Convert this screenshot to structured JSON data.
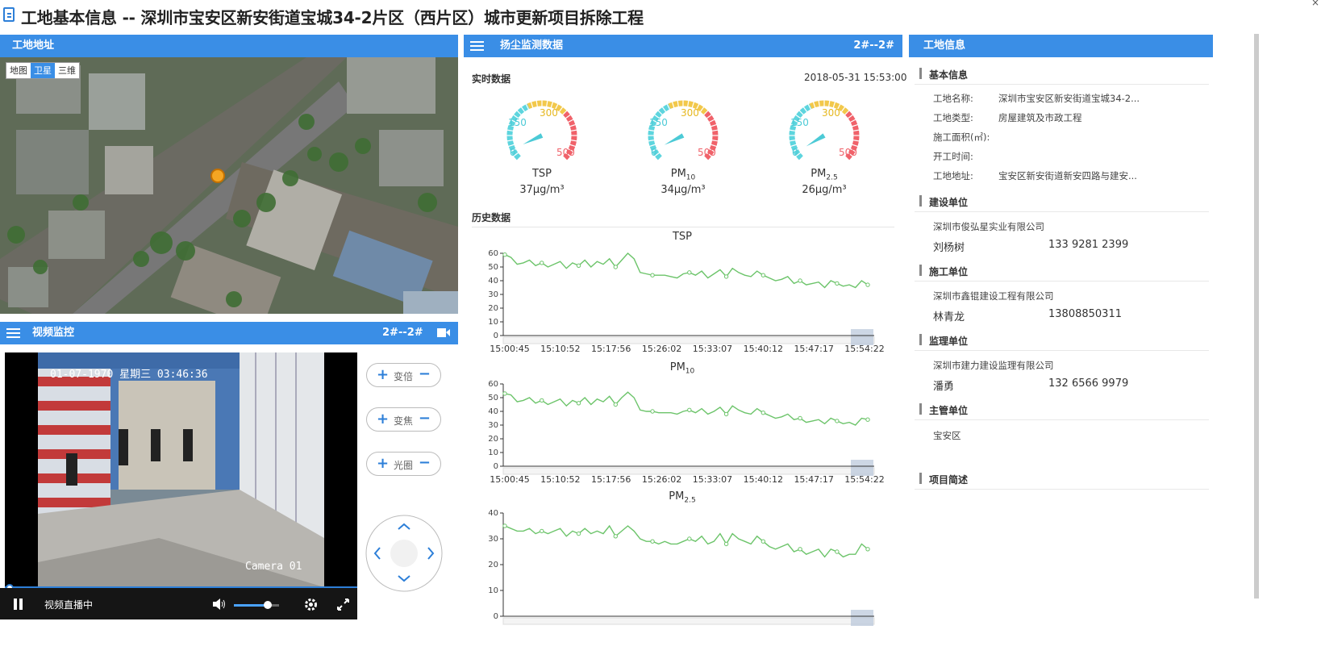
{
  "page": {
    "title": "工地基本信息 -- 深圳市宝安区新安街道宝城34-2片区（西片区）城市更新项目拆除工程",
    "close": "×"
  },
  "map_panel": {
    "title": "工地地址",
    "tabs": [
      "地图",
      "卫星",
      "三维"
    ],
    "active_tab": "卫星"
  },
  "video_panel": {
    "title": "视频监控",
    "camera_id": "2#--2#",
    "osd_datetime": "01-07-1970 星期三 03:46:36",
    "osd_camera": "Camera 01",
    "status": "视频直播中",
    "volume": 0.75,
    "controls": [
      {
        "label": "变倍",
        "plus": "+",
        "minus": "−"
      },
      {
        "label": "变焦",
        "plus": "+",
        "minus": "−"
      },
      {
        "label": "光圈",
        "plus": "+",
        "minus": "−"
      }
    ]
  },
  "dust_panel": {
    "title": "扬尘监测数据",
    "device": "2#--2#",
    "realtime_label": "实时数据",
    "timestamp": "2018-05-31 15:53:00",
    "history_label": "历史数据",
    "gauges": [
      {
        "name": "TSP",
        "sub": "",
        "value": "37μg/m³",
        "level": 37
      },
      {
        "name": "PM",
        "sub": "10",
        "value": "34μg/m³",
        "level": 34
      },
      {
        "name": "PM",
        "sub": "2.5",
        "value": "26μg/m³",
        "level": 26
      }
    ],
    "gauge_ticks": [
      "0",
      "150",
      "300",
      "500"
    ]
  },
  "chart_data": [
    {
      "type": "line",
      "title": "TSP",
      "ylim": [
        0,
        60
      ],
      "yticks": [
        0,
        10,
        20,
        30,
        40,
        50,
        60
      ],
      "xticks": [
        "15:00:45",
        "15:10:52",
        "15:17:56",
        "15:26:02",
        "15:33:07",
        "15:40:12",
        "15:47:17",
        "15:54:22"
      ],
      "values": [
        59,
        57,
        52,
        53,
        55,
        51,
        53,
        50,
        52,
        54,
        49,
        53,
        51,
        55,
        50,
        54,
        52,
        56,
        50,
        55,
        60,
        56,
        46,
        45,
        44,
        44,
        44,
        43,
        42,
        45,
        46,
        44,
        47,
        42,
        45,
        48,
        43,
        49,
        46,
        44,
        43,
        47,
        44,
        42,
        40,
        41,
        43,
        38,
        40,
        37,
        38,
        39,
        35,
        40,
        38,
        36,
        37,
        35,
        40,
        37
      ]
    },
    {
      "type": "line",
      "title": "PM10",
      "ylim": [
        0,
        60
      ],
      "yticks": [
        0,
        10,
        20,
        30,
        40,
        50,
        60
      ],
      "xticks": [
        "15:00:45",
        "15:10:52",
        "15:17:56",
        "15:26:02",
        "15:33:07",
        "15:40:12",
        "15:47:17",
        "15:54:22"
      ],
      "values": [
        53,
        52,
        47,
        48,
        50,
        46,
        48,
        45,
        47,
        49,
        44,
        48,
        46,
        50,
        45,
        49,
        47,
        51,
        45,
        50,
        54,
        50,
        41,
        40,
        40,
        39,
        39,
        39,
        38,
        40,
        41,
        39,
        42,
        38,
        40,
        43,
        38,
        44,
        41,
        39,
        38,
        42,
        39,
        37,
        35,
        36,
        38,
        34,
        35,
        32,
        33,
        34,
        31,
        35,
        33,
        31,
        32,
        30,
        35,
        34
      ]
    },
    {
      "type": "line",
      "title": "PM2.5",
      "ylim": [
        0,
        40
      ],
      "yticks": [
        0,
        10,
        20,
        30,
        40
      ],
      "xticks": [
        "15:00:45",
        "15:10:52",
        "15:17:56",
        "15:26:02",
        "15:33:07",
        "15:40:12",
        "15:47:17",
        "15:54:22"
      ],
      "values": [
        35,
        34,
        33,
        33,
        34,
        32,
        33,
        32,
        33,
        34,
        31,
        33,
        32,
        34,
        32,
        33,
        32,
        35,
        31,
        33,
        35,
        33,
        30,
        29,
        29,
        28,
        29,
        28,
        28,
        29,
        30,
        29,
        31,
        28,
        29,
        32,
        28,
        32,
        30,
        29,
        28,
        31,
        29,
        27,
        26,
        27,
        28,
        25,
        26,
        24,
        25,
        26,
        23,
        26,
        25,
        23,
        24,
        24,
        28,
        26
      ]
    }
  ],
  "info_panel": {
    "title": "工地信息",
    "basic": {
      "heading": "基本信息",
      "rows": [
        {
          "k": "工地名称:",
          "v": "深圳市宝安区新安街道宝城34-2..."
        },
        {
          "k": "工地类型:",
          "v": "房屋建筑及市政工程"
        },
        {
          "k": "施工面积(㎡):",
          "v": ""
        },
        {
          "k": "开工时间:",
          "v": ""
        },
        {
          "k": "工地地址:",
          "v": "宝安区新安街道新安四路与建安..."
        }
      ]
    },
    "builder": {
      "heading": "建设单位",
      "company": "深圳市俊弘星实业有限公司",
      "person": "刘杨树",
      "phone": "133 9281 2399"
    },
    "constructor": {
      "heading": "施工单位",
      "company": "深圳市鑫锟建设工程有限公司",
      "person": "林青龙",
      "phone": "13808850311"
    },
    "supervisor": {
      "heading": "监理单位",
      "company": "深圳市建力建设监理有限公司",
      "person": "潘勇",
      "phone": "132 6566 9979"
    },
    "authority": {
      "heading": "主管单位",
      "company": "宝安区"
    },
    "summary": {
      "heading": "项目简述"
    }
  }
}
